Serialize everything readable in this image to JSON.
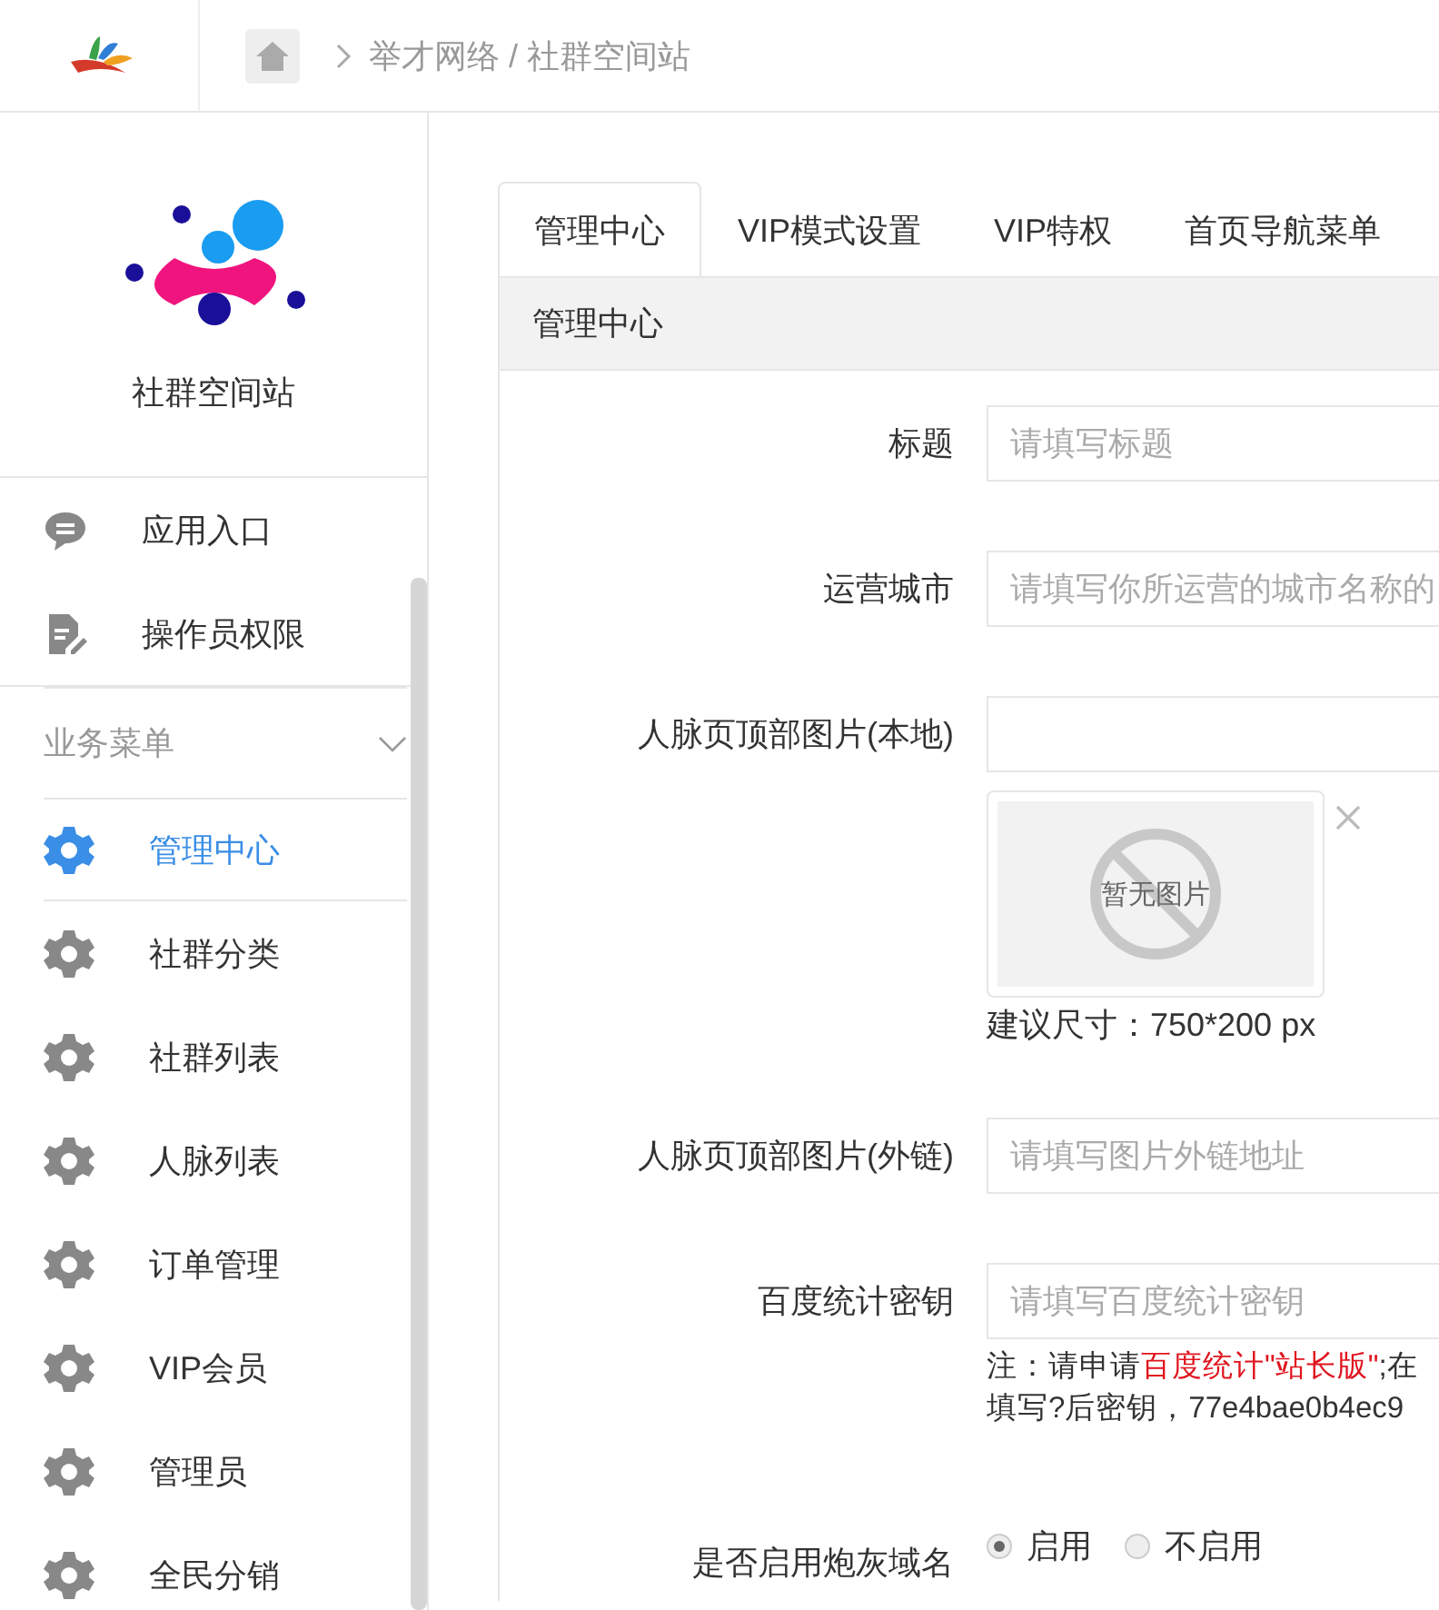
{
  "header": {
    "breadcrumb": "举才网络 / 社群空间站"
  },
  "sidebar": {
    "site_name": "社群空间站",
    "top_items": [
      {
        "label": "应用入口"
      },
      {
        "label": "操作员权限"
      }
    ],
    "section": {
      "label": "业务菜单",
      "expanded": true
    },
    "items": [
      {
        "label": "管理中心",
        "selected": true
      },
      {
        "label": "社群分类",
        "selected": false
      },
      {
        "label": "社群列表",
        "selected": false
      },
      {
        "label": "人脉列表",
        "selected": false
      },
      {
        "label": "订单管理",
        "selected": false
      },
      {
        "label": "VIP会员",
        "selected": false
      },
      {
        "label": "管理员",
        "selected": false
      },
      {
        "label": "全民分销",
        "selected": false
      }
    ]
  },
  "tabs": [
    {
      "label": "管理中心",
      "selected": true
    },
    {
      "label": "VIP模式设置",
      "selected": false
    },
    {
      "label": "VIP特权",
      "selected": false
    },
    {
      "label": "首页导航菜单",
      "selected": false
    }
  ],
  "panel": {
    "title": "管理中心",
    "rows": [
      {
        "kind": "text",
        "label": "标题",
        "placeholder": "请填写标题"
      },
      {
        "kind": "text",
        "label": "运营城市",
        "placeholder": "请填写你所运营的城市名称的"
      },
      {
        "kind": "upload",
        "label": "人脉页顶部图片(本地)",
        "empty_text": "暂无图片",
        "hint": "建议尺寸：750*200 px"
      },
      {
        "kind": "text",
        "label": "人脉页顶部图片(外链)",
        "placeholder": "请填写图片外链地址"
      },
      {
        "kind": "text",
        "label": "百度统计密钥",
        "placeholder": "请填写百度统计密钥",
        "note": [
          [
            {
              "text": "注：请申请",
              "highlight": false
            },
            {
              "text": "百度统计\"站长版\"",
              "highlight": true
            },
            {
              "text": ";在",
              "highlight": false
            }
          ],
          [
            {
              "text": "填写?后密钥，77e4bae0b4ec9",
              "highlight": false
            }
          ]
        ]
      },
      {
        "kind": "radio",
        "label": "是否启用炮灰域名",
        "options": [
          {
            "label": "启用",
            "selected": true
          },
          {
            "label": "不启用",
            "selected": false
          }
        ]
      }
    ]
  }
}
